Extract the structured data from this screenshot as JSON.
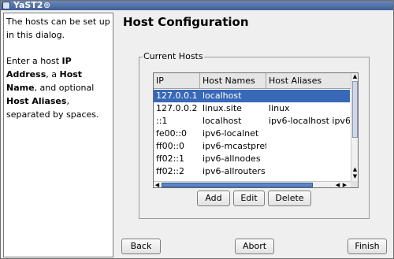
{
  "window": {
    "title": "YaST2"
  },
  "help": {
    "p1": "The hosts can be set up in this dialog.",
    "p2_pre": "Enter a host ",
    "p2_b1": "IP Address",
    "p2_mid1": ", a ",
    "p2_b2": "Host Name",
    "p2_mid2": ", and optional ",
    "p2_b3": "Host Aliases",
    "p2_post": ", separated by spaces."
  },
  "heading": "Host Configuration",
  "group": {
    "label": "Current Hosts"
  },
  "table": {
    "columns": [
      "IP Address",
      "Host Names",
      "Host Aliases"
    ],
    "rows": [
      [
        "127.0.0.1",
        "localhost",
        ""
      ],
      [
        "127.0.0.2",
        "linux.site",
        "linux"
      ],
      [
        "::1",
        "localhost",
        "ipv6-localhost ipv6-lo"
      ],
      [
        "fe00::0",
        "ipv6-localnet",
        ""
      ],
      [
        "ff00::0",
        "ipv6-mcastprefix",
        ""
      ],
      [
        "ff02::1",
        "ipv6-allnodes",
        ""
      ],
      [
        "ff02::2",
        "ipv6-allrouters",
        ""
      ]
    ],
    "selected_row": 0
  },
  "buttons": {
    "add": "Add",
    "edit": "Edit",
    "delete": "Delete",
    "back": "Back",
    "abort": "Abort",
    "finish": "Finish"
  },
  "colors": {
    "selection": "#3868b8",
    "titlebar": "#4a6aa5"
  }
}
